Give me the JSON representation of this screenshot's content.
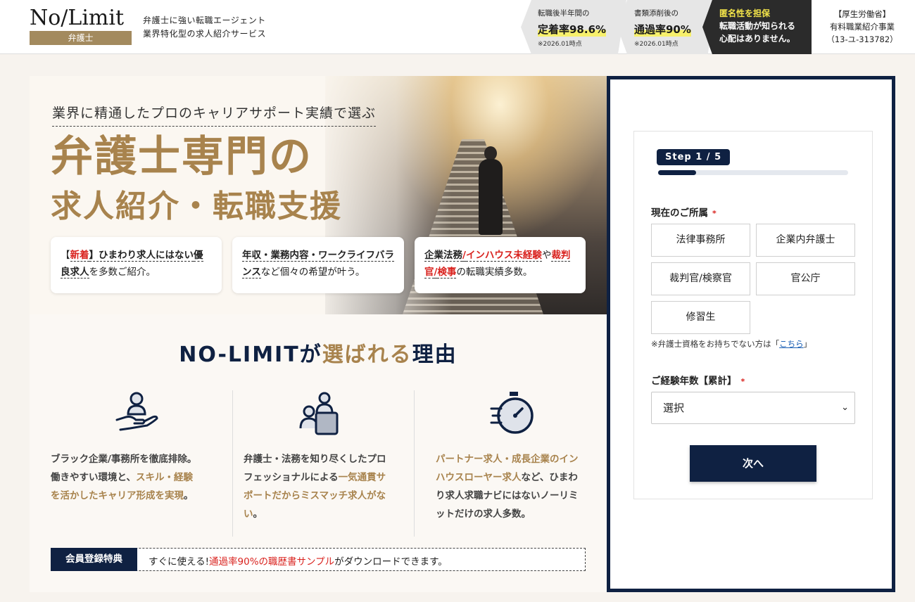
{
  "header": {
    "logo": "No/Limit",
    "logo_sub": "弁護士",
    "tagline_1": "弁護士に強い転職エージェント",
    "tagline_2": "業界特化型の求人紹介サービス",
    "stat1": {
      "label": "転職後半年間の",
      "value": "定着率98.6%",
      "note": "※2026.01時点"
    },
    "stat2": {
      "label": "書類添削後の",
      "value": "通過率90%",
      "note": "※2026.01時点"
    },
    "stat3": {
      "line1": "匿名性を担保",
      "line2": "転職活動が知られる",
      "line3": "心配はありません。"
    },
    "license_1": "【厚生労働省】",
    "license_2": "有料職業紹介事業",
    "license_3": "（13-ユ-313782）"
  },
  "hero": {
    "catch": "業界に精通したプロのキャリアサポート実績で選ぶ",
    "title_1": "弁護士専門の",
    "title_2": "求人紹介・転職支援",
    "card1": {
      "pre": "【",
      "new": "新着",
      "mid": "】ひまわり求人にはない",
      "u": "優良求人",
      "post": "を多数ご紹介。"
    },
    "card2": {
      "u": "年収・業務内容・ワークライフバランス",
      "post": "など個々の希望が叶う。"
    },
    "card3": {
      "u1": "企業法務",
      "sep1": "/",
      "r1": "インハウス未経験",
      "mid": "や",
      "r2": "裁判官",
      "sep2": "/",
      "r3": "検事",
      "post": "の転職実績多数。"
    }
  },
  "reasons": {
    "title_a": "NO-LIMITが",
    "title_b": "選ばれる",
    "title_c": "理由",
    "col1": {
      "text_a": "ブラック企業/事務所を徹底排除。働きやすい環境と、",
      "text_gold": "スキル・経験を活かしたキャリア形成を実現",
      "text_b": "。"
    },
    "col2": {
      "text_a": "弁護士・法務を知り尽くしたプロフェッショナルによる",
      "text_gold": "一気通貫サポートだからミスマッチ求人がない",
      "text_b": "。"
    },
    "col3": {
      "text_gold": "パートナー求人・成長企業のインハウスローヤー求人",
      "text_b": "など、ひまわり求人求職ナビにはないノーリミットだけの求人多数。"
    },
    "member_badge": "会員登録特典",
    "member_a": "すぐに使える!",
    "member_red": "通過率90%の職歴書サンプル",
    "member_b": "がダウンロードできます。"
  },
  "form": {
    "step": "Step 1 / 5",
    "progress": 0.2,
    "affiliation_label": "現在のご所属",
    "required_mark": "*",
    "options": [
      "法律事務所",
      "企業内弁護士",
      "裁判官/検察官",
      "官公庁",
      "修習生"
    ],
    "note_a": "※弁護士資格をお持ちでない方は「",
    "note_link": "こちら",
    "note_b": "」",
    "experience_label": "ご経験年数【累計】",
    "select_value": "選択",
    "next_label": "次へ"
  }
}
